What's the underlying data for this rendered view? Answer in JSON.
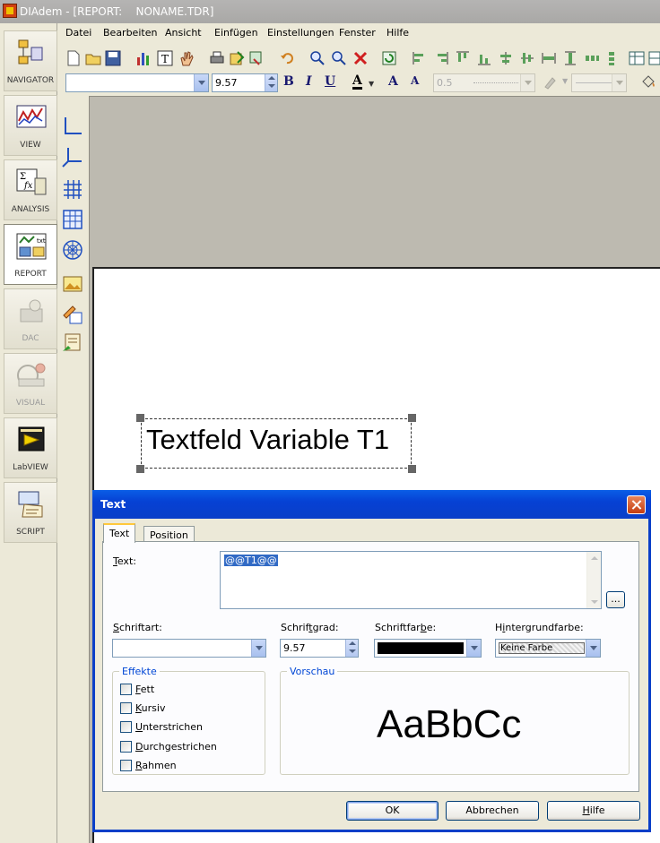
{
  "window": {
    "title": "DIAdem - [REPORT:    NONAME.TDR]"
  },
  "modules": [
    {
      "label": "NAVIGATOR",
      "icon": "navigator-icon",
      "state": "normal"
    },
    {
      "label": "VIEW",
      "icon": "view-icon",
      "state": "normal"
    },
    {
      "label": "ANALYSIS",
      "icon": "analysis-icon",
      "state": "normal"
    },
    {
      "label": "REPORT",
      "icon": "report-icon",
      "state": "active"
    },
    {
      "label": "DAC",
      "icon": "dac-icon",
      "state": "disabled"
    },
    {
      "label": "VISUAL",
      "icon": "visual-icon",
      "state": "disabled"
    },
    {
      "label": "LabVIEW",
      "icon": "labview-icon",
      "state": "normal"
    },
    {
      "label": "SCRIPT",
      "icon": "script-icon",
      "state": "normal"
    }
  ],
  "menu": [
    "Datei",
    "Bearbeiten",
    "Ansicht",
    "Einfügen",
    "Einstellungen",
    "Fenster",
    "Hilfe"
  ],
  "format_toolbar": {
    "font_size": "9.57",
    "bold_label": "B",
    "italic_label": "I",
    "underline_label": "U",
    "font_color_label": "A",
    "grow_font_label": "A",
    "shrink_font_label": "A",
    "line_width": "0.5"
  },
  "report": {
    "textframe_text": "Textfeld Variable T1"
  },
  "dialog": {
    "title": "Text",
    "tabs": [
      "Text",
      "Position"
    ],
    "active_tab": "Text",
    "text_label": "Text:",
    "text_value": "@@T1@@",
    "dots_button": "...",
    "font_label": "Schriftart:",
    "font_value": "",
    "size_label": "Schriftgrad:",
    "size_value": "9.57",
    "color_label": "Schriftfarbe:",
    "color_value": "#000000",
    "bg_label": "Hintergrundfarbe:",
    "bg_value": "Keine Farbe",
    "effects_title": "Effekte",
    "effects": [
      {
        "label": "Fett",
        "checked": false
      },
      {
        "label": "Kursiv",
        "checked": false
      },
      {
        "label": "Unterstrichen",
        "checked": false
      },
      {
        "label": "Durchgestrichen",
        "checked": false
      },
      {
        "label": "Rahmen",
        "checked": false
      }
    ],
    "preview_title": "Vorschau",
    "preview_text": "AaBbCc",
    "ok_button": "OK",
    "cancel_button": "Abbrechen",
    "help_button": "Hilfe"
  },
  "colors": {
    "accent_title": "#0a3fc8",
    "selection": "#316ac5"
  }
}
